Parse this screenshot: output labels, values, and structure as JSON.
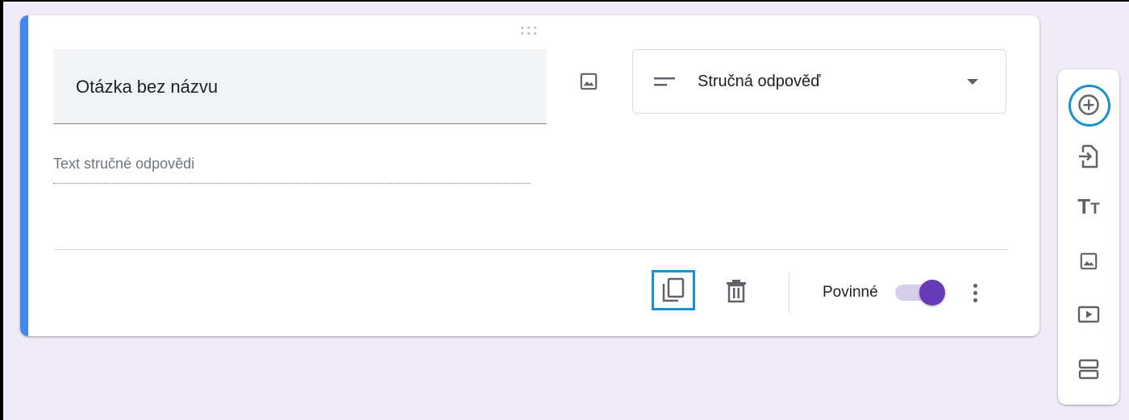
{
  "question": {
    "title": "Otázka bez názvu",
    "answer_placeholder": "Text stručné odpovědi",
    "type_label": "Stručná odpověď"
  },
  "footer": {
    "required_label": "Povinné",
    "required_on": true
  },
  "icons": {
    "drag": "drag-handle-icon",
    "image": "image-icon",
    "short_answer": "short-answer-icon",
    "dropdown": "chevron-down-icon",
    "copy": "copy-icon",
    "delete": "trash-icon",
    "more": "more-vert-icon",
    "add": "add-circle-icon",
    "import": "import-icon",
    "title": "title-text-icon",
    "add_image": "image-icon",
    "video": "video-icon",
    "section": "section-icon"
  },
  "colors": {
    "accent": "#4285f4",
    "toggle": "#673ab7",
    "focus": "#1a8fd6",
    "background": "#f0ebf8"
  }
}
